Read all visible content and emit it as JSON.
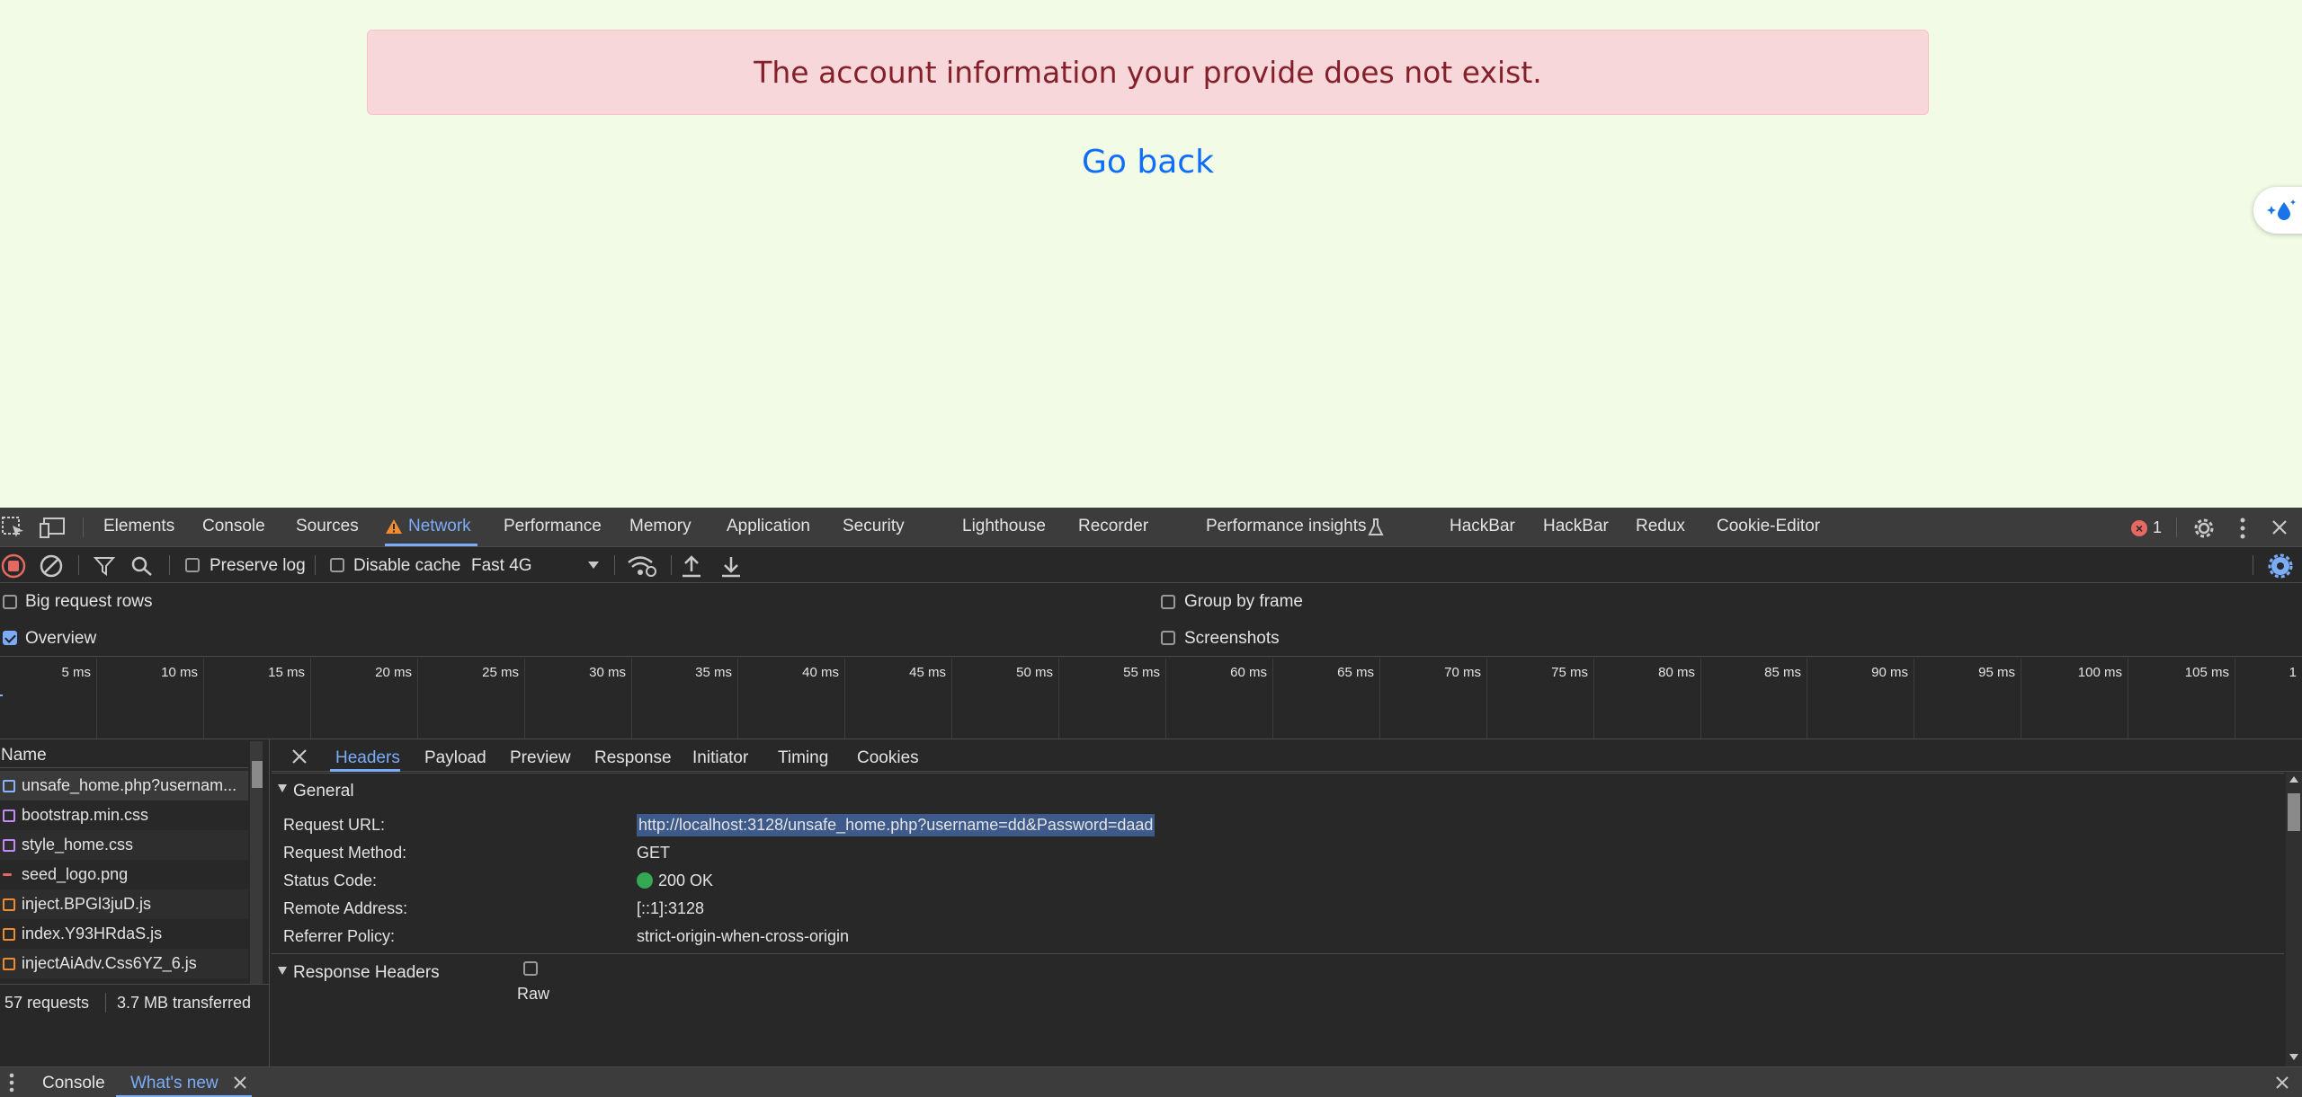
{
  "page": {
    "alert_text": "The account information your provide does not exist.",
    "go_back_label": "Go back"
  },
  "devtools": {
    "tabs": [
      "Elements",
      "Console",
      "Sources",
      "Network",
      "Performance",
      "Memory",
      "Application",
      "Security",
      "Lighthouse",
      "Recorder",
      "Performance insights",
      "HackBar",
      "HackBar",
      "Redux",
      "Cookie-Editor"
    ],
    "active_tab": "Network",
    "error_count": "1",
    "toolbar": {
      "preserve_log": "Preserve log",
      "disable_cache": "Disable cache",
      "throttling": "Fast 4G"
    },
    "settings": {
      "big_request_rows": "Big request rows",
      "overview": "Overview",
      "group_by_frame": "Group by frame",
      "screenshots": "Screenshots"
    },
    "timeline_labels": [
      "5 ms",
      "10 ms",
      "15 ms",
      "20 ms",
      "25 ms",
      "30 ms",
      "35 ms",
      "40 ms",
      "45 ms",
      "50 ms",
      "55 ms",
      "60 ms",
      "65 ms",
      "70 ms",
      "75 ms",
      "80 ms",
      "85 ms",
      "90 ms",
      "95 ms",
      "100 ms",
      "105 ms",
      "1"
    ],
    "requests": {
      "name_header": "Name",
      "files": [
        "unsafe_home.php?usernam...",
        "bootstrap.min.css",
        "style_home.css",
        "seed_logo.png",
        "inject.BPGl3juD.js",
        "index.Y93HRdaS.js",
        "injectAiAdv.Css6YZ_6.js"
      ],
      "count": "57 requests",
      "transferred": "3.7 MB transferred"
    },
    "detail": {
      "tabs": [
        "Headers",
        "Payload",
        "Preview",
        "Response",
        "Initiator",
        "Timing",
        "Cookies"
      ],
      "general_label": "General",
      "request_url_label": "Request URL:",
      "request_url": "http://localhost:3128/unsafe_home.php?username=dd&Password=daad",
      "request_method_label": "Request Method:",
      "request_method": "GET",
      "status_code_label": "Status Code:",
      "status_code": "200 OK",
      "remote_address_label": "Remote Address:",
      "remote_address": "[::1]:3128",
      "referrer_policy_label": "Referrer Policy:",
      "referrer_policy": "strict-origin-when-cross-origin",
      "response_headers_label": "Response Headers",
      "raw_label": "Raw"
    },
    "drawer": {
      "console": "Console",
      "whats_new": "What's new"
    }
  }
}
